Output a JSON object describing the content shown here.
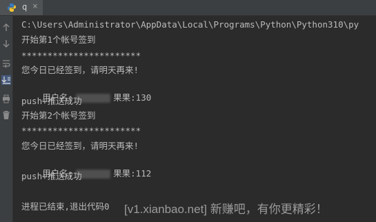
{
  "tab": {
    "label": "q",
    "close": "×"
  },
  "console": {
    "lines": [
      "C:\\Users\\Administrator\\AppData\\Local\\Programs\\Python\\Python310\\py",
      "开始第1个帐号签到",
      "***********************",
      "您今日已经签到，请明天再来!",
      {
        "prefix": "用户名:",
        "suffix": "果果:130"
      },
      "push+推送成功",
      "开始第2个帐号签到",
      "***********************",
      "您今日已经签到，请明天再来!",
      {
        "prefix": "用户名:",
        "suffix": "果果:112"
      },
      "push+推送成功",
      "",
      "进程已结束,退出代码0"
    ]
  },
  "watermark": "[v1.xianbao.net] 新赚吧，有你更精彩！",
  "colors": {
    "background": "#2b2b2b",
    "text": "#bbbbbb",
    "chrome": "#3c3f41"
  },
  "gutter_icons": [
    "rerun-icon",
    "scroll-up-icon",
    "scroll-down-icon",
    "soft-wrap-icon",
    "scroll-to-end-icon",
    "print-icon",
    "trash-icon"
  ]
}
